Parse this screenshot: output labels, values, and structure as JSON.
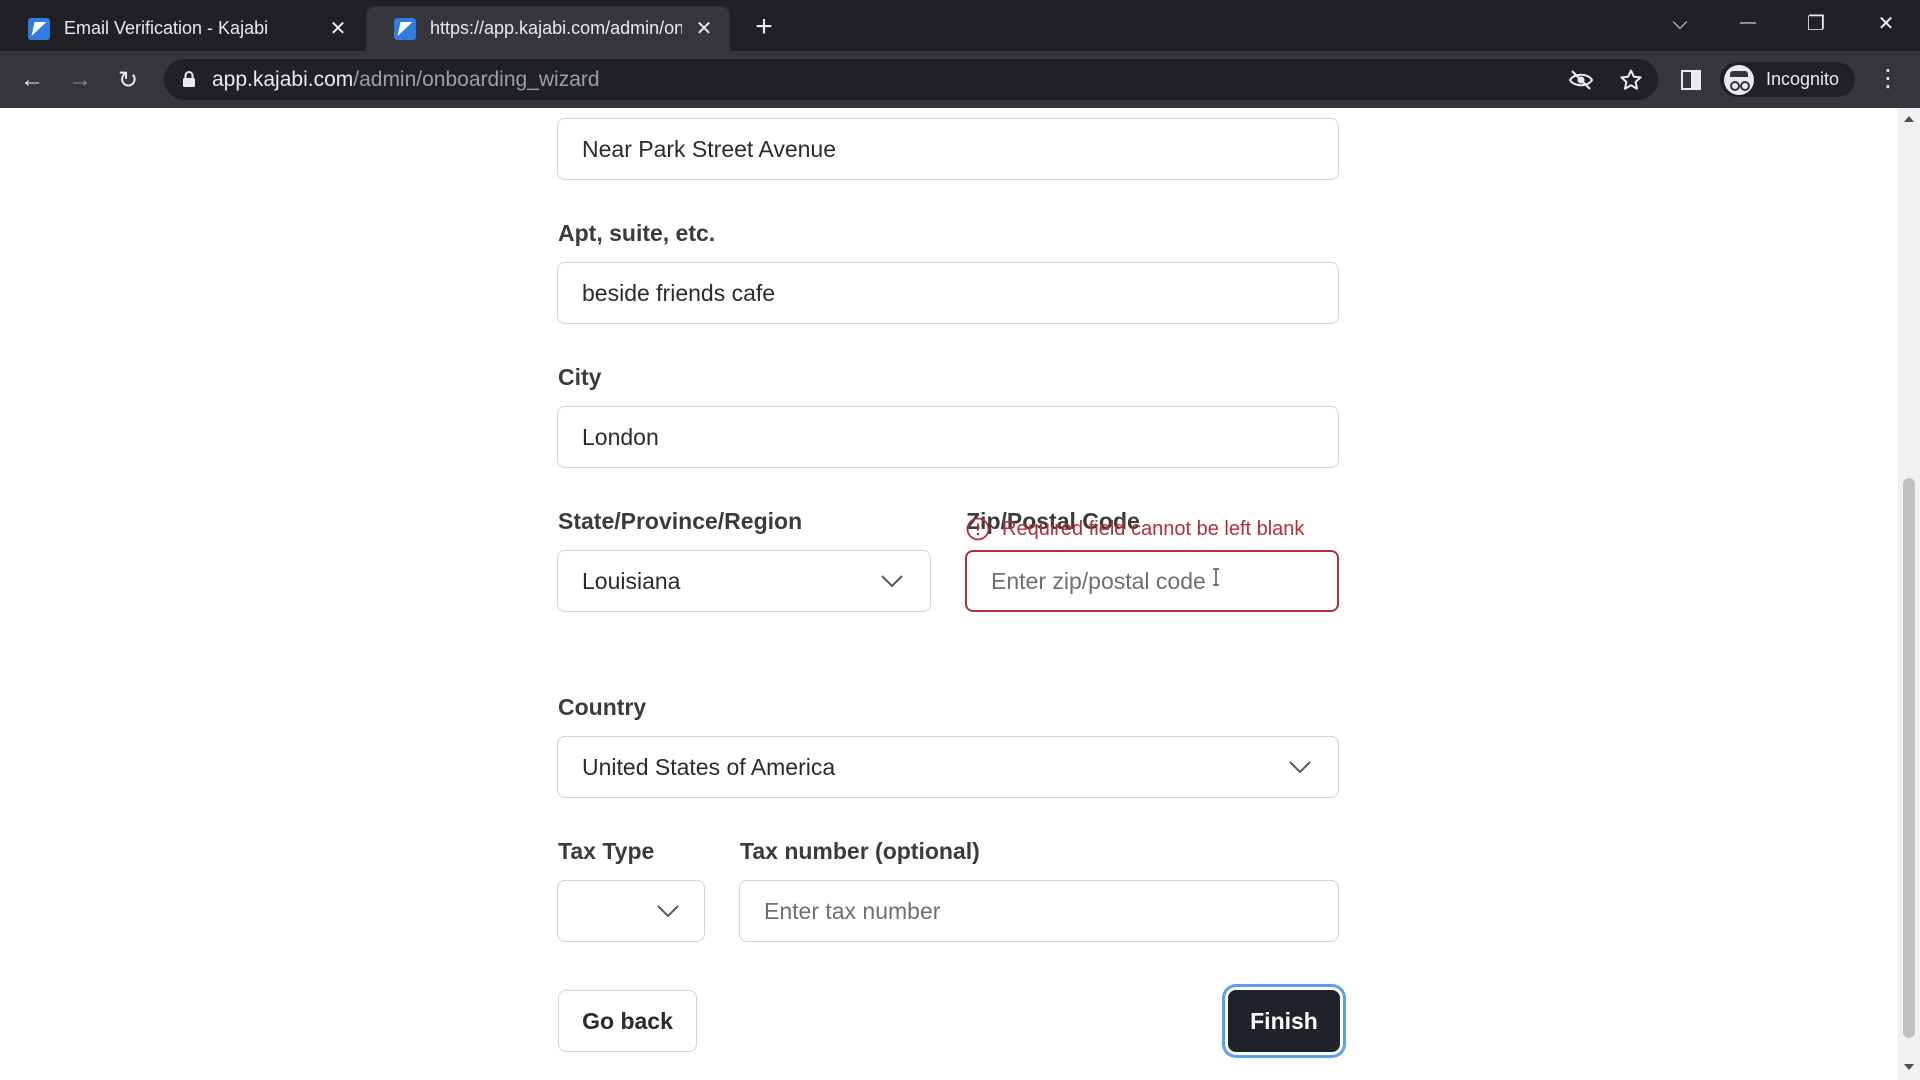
{
  "browser": {
    "tabs": [
      {
        "title": "Email Verification - Kajabi",
        "close": "✕"
      },
      {
        "title": "https://app.kajabi.com/admin/onboarding_wizard",
        "close": "✕"
      }
    ],
    "new_tab": "+",
    "window_controls": {
      "tab_search": "⌵",
      "minimize": "—",
      "restore": "❐",
      "close": "✕"
    },
    "nav": {
      "back": "←",
      "forward": "→",
      "reload": "↻"
    },
    "url": {
      "host": "app.kajabi.com",
      "path": "/admin/onboarding_wizard"
    },
    "profile_label": "Incognito",
    "menu": "⋮",
    "accent": "#2f7de1"
  },
  "form": {
    "address": {
      "value": "Near Park Street Avenue"
    },
    "apt": {
      "label": "Apt, suite, etc.",
      "value": "beside friends cafe"
    },
    "city": {
      "label": "City",
      "value": "London"
    },
    "state": {
      "label": "State/Province/Region",
      "value": "Louisiana"
    },
    "zip": {
      "label": "Zip/Postal Code",
      "value": "",
      "placeholder": "Enter zip/postal code",
      "error": "Required field cannot be left blank"
    },
    "country": {
      "label": "Country",
      "value": "United States of America"
    },
    "tax_type": {
      "label": "Tax Type",
      "value": ""
    },
    "tax_number": {
      "label": "Tax number (optional)",
      "value": "",
      "placeholder": "Enter tax number"
    },
    "back_label": "Go back",
    "finish_label": "Finish",
    "error_color": "#b32d3a"
  }
}
